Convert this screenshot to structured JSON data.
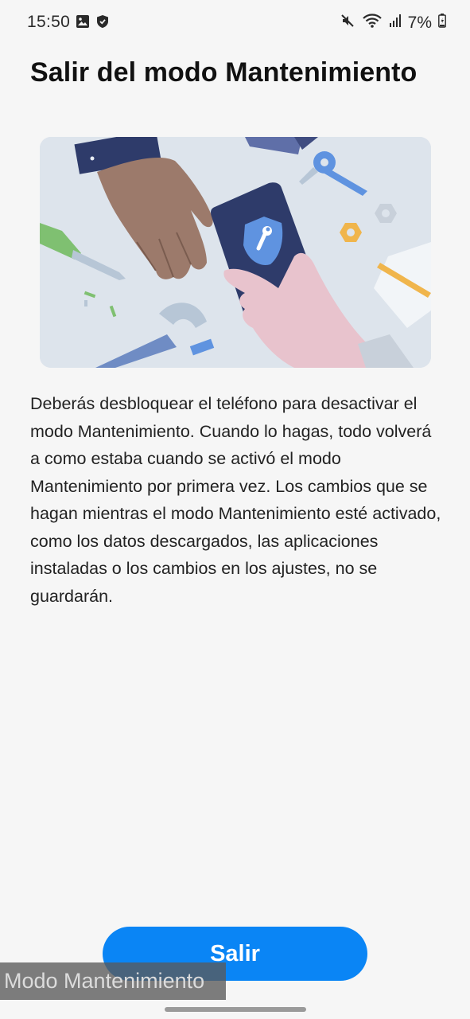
{
  "status_bar": {
    "time": "15:50",
    "left_icons": [
      "gallery-icon",
      "shield-icon"
    ],
    "right_icons": [
      "mute-icon",
      "wifi-icon",
      "signal-icon",
      "battery-icon"
    ],
    "battery": "7%"
  },
  "page": {
    "title": "Salir del modo Mantenimiento",
    "description": "Deberás desbloquear el teléfono para desactivar el modo Mantenimiento. Cuando lo hagas, todo volverá a como estaba cuando se activó el modo Mantenimiento por primera vez. Los cambios que se hagan mientras el modo Mantenimiento esté activado, como los datos descargados, las aplicaciones instaladas o los cambios en los ajustes, no se guardarán."
  },
  "actions": {
    "exit_label": "Salir"
  },
  "overlay": {
    "mode_label": "Modo Mantenimiento"
  },
  "colors": {
    "accent": "#0a85f5",
    "background": "#f6f6f6",
    "illustration_bg": "#dde4ec"
  }
}
